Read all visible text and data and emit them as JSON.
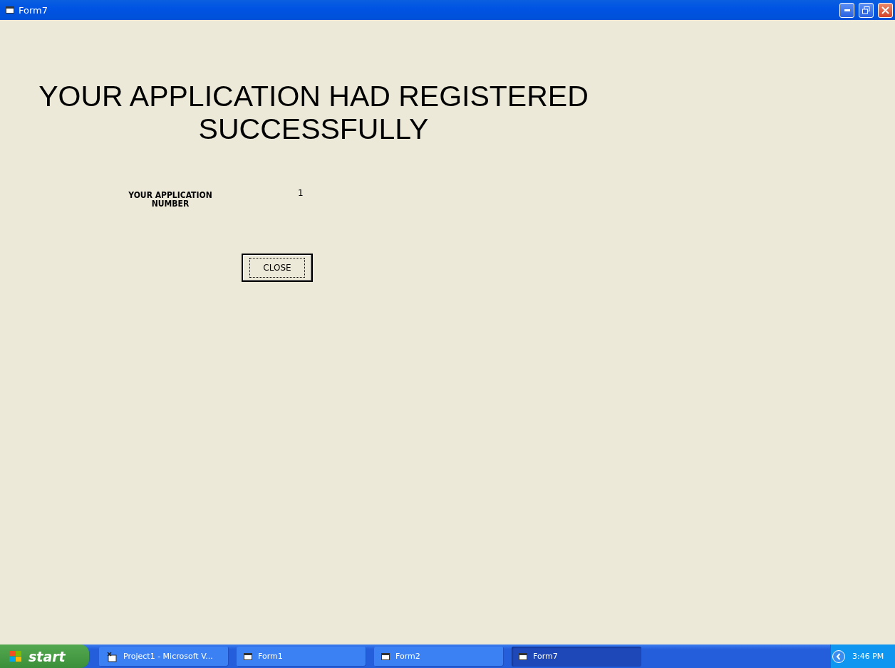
{
  "window": {
    "title": "Form7"
  },
  "heading": [
    "YOUR APPLICATION HAD REGISTERED",
    "SUCCESSFULLY"
  ],
  "application_number": {
    "label": [
      "YOUR APPLICATION",
      "NUMBER"
    ],
    "value": "1"
  },
  "close_button": {
    "label": "CLOSE"
  },
  "taskbar": {
    "start": "start",
    "tasks": [
      {
        "label": "Project1 - Microsoft V...",
        "kind": "vb",
        "selected": false
      },
      {
        "label": "Form1",
        "kind": "form",
        "selected": false
      },
      {
        "label": "Form2",
        "kind": "form",
        "selected": false
      },
      {
        "label": "Form7",
        "kind": "form",
        "selected": true
      }
    ],
    "clock": "3:46 PM"
  }
}
